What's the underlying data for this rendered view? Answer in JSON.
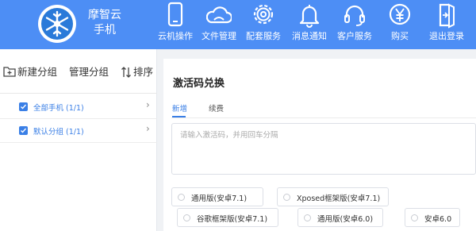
{
  "app": {
    "brand_line1": "摩智云",
    "brand_line2": "手机"
  },
  "nav": [
    {
      "label": "云机操作",
      "icon": "phone-icon"
    },
    {
      "label": "文件管理",
      "icon": "cloud-icon"
    },
    {
      "label": "配套服务",
      "icon": "gear-icon"
    },
    {
      "label": "消息通知",
      "icon": "bell-icon"
    },
    {
      "label": "客户服务",
      "icon": "headset-icon"
    },
    {
      "label": "购买",
      "icon": "yen-icon"
    },
    {
      "label": "退出登录",
      "icon": "logout-icon"
    }
  ],
  "sidebar": {
    "new_group": "新建分组",
    "manage_group": "管理分组",
    "sort": "排序",
    "groups": [
      {
        "label": "全部手机 (1/1)",
        "checked": true
      },
      {
        "label": "默认分组 (1/1)",
        "checked": true
      }
    ]
  },
  "main": {
    "title": "激活码兑换",
    "tabs": [
      {
        "label": "新增",
        "active": true
      },
      {
        "label": "续费",
        "active": false
      }
    ],
    "textarea_placeholder": "请输入激活码，并用回车分隔",
    "options": [
      "通用版(安卓7.1)",
      "Xposed框架版(安卓7.1)",
      "谷歌框架版(安卓7.1)",
      "通用版(安卓6.0)",
      "安卓6.0"
    ]
  },
  "colors": {
    "header_bg": "#4d8ef5",
    "accent": "#3a7fe6"
  }
}
